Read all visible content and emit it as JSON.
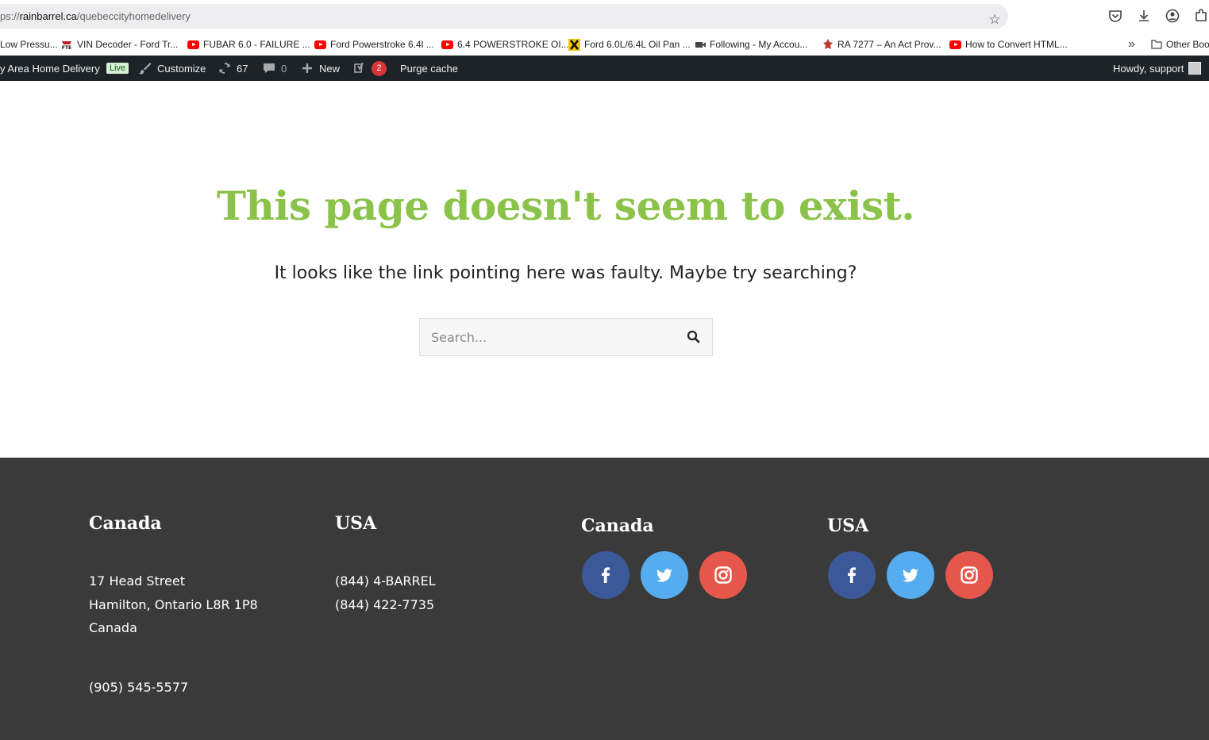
{
  "browser": {
    "url_prefix": "ps://",
    "url_host": "rainbarrel.ca",
    "url_path": "/quebeccityhomedelivery"
  },
  "bookmarks": [
    {
      "label": "Low Pressu...",
      "icon": "none"
    },
    {
      "label": "VIN Decoder - Ford Tr...",
      "icon": "fte-icon"
    },
    {
      "label": "FUBAR 6.0 - FAILURE ...",
      "icon": "youtube-icon"
    },
    {
      "label": "Ford Powerstroke 6.4l ...",
      "icon": "youtube-icon"
    },
    {
      "label": "6.4 POWERSTROKE OI...",
      "icon": "youtube-icon"
    },
    {
      "label": "Ford 6.0L/6.4L Oil Pan ...",
      "icon": "x-icon"
    },
    {
      "label": "Following - My Accou...",
      "icon": "camera-icon"
    },
    {
      "label": "RA 7277 – An Act Prov...",
      "icon": "ra-icon"
    },
    {
      "label": "How to Convert HTML...",
      "icon": "youtube-icon"
    }
  ],
  "bookmarks_other": "Other Boo",
  "admin_bar": {
    "site_name": "y Area Home Delivery",
    "live_badge": "Live",
    "customize": "Customize",
    "updates_count": "67",
    "comments_count": "0",
    "new_label": "New",
    "yoast_count": "2",
    "purge_cache": "Purge cache",
    "howdy": "Howdy, support"
  },
  "main": {
    "title": "This page doesn't seem to exist.",
    "subtitle": "It looks like the link pointing here was faulty. Maybe try searching?",
    "search_placeholder": "Search..."
  },
  "footer": {
    "col1": {
      "heading": "Canada",
      "address1": "17 Head Street",
      "address2": "Hamilton, Ontario L8R 1P8",
      "address3": "Canada",
      "phone": "(905) 545-5577"
    },
    "col2": {
      "heading": "USA",
      "phone1": "(844) 4-BARREL",
      "phone2": "(844) 422-7735"
    },
    "col3": {
      "heading": "Canada"
    },
    "col4": {
      "heading": "USA"
    }
  },
  "colors": {
    "accent_green": "#8bc34a",
    "facebook": "#3b5998",
    "twitter": "#55acee",
    "instagram": "#e4574a",
    "footer_bg": "#3a3a3a",
    "admin_bar_bg": "#1d2327"
  }
}
